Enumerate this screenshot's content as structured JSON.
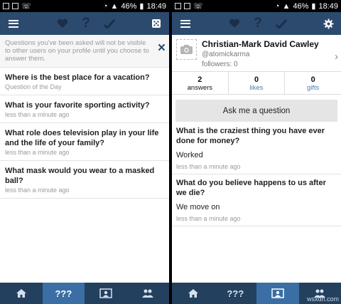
{
  "colors": {
    "appbar": "#2c4a6e",
    "bottombar": "#23405f",
    "active_tab": "#3a6ea5",
    "link_blue": "#4a7fb0"
  },
  "status": {
    "battery": "46%",
    "time": "18:49"
  },
  "left": {
    "notice": "Questions you've been asked will not be visible to other users on your profile until you choose to answer them.",
    "close_icon": "×",
    "questions": [
      {
        "text": "Where is the best place for a vacation?",
        "sub": "Question of the Day"
      },
      {
        "text": "What is your favorite sporting activity?",
        "sub": "less than a minute ago"
      },
      {
        "text": "What role does television play in your life and the life of your family?",
        "sub": "less than a minute ago"
      },
      {
        "text": "What mask would you wear to a masked ball?",
        "sub": "less than a minute ago"
      }
    ]
  },
  "right": {
    "profile": {
      "name": "Christian-Mark David Cawley",
      "handle": "@atomickarma",
      "followers": "followers: 0"
    },
    "stats": [
      {
        "num": "2",
        "label": "answers"
      },
      {
        "num": "0",
        "label": "likes"
      },
      {
        "num": "0",
        "label": "gifts"
      }
    ],
    "ask_button": "Ask me a question",
    "answers": [
      {
        "question": "What is the craziest  thing you have ever done for money?",
        "answer": "Worked",
        "time": "less than a minute ago"
      },
      {
        "question": "What do you believe happens to us after we die?",
        "answer": "We move on",
        "time": "less than a minute ago"
      }
    ]
  },
  "nav": {
    "qqq_label": "???",
    "appbar_q": "?"
  },
  "watermark": "wsxdn.com"
}
